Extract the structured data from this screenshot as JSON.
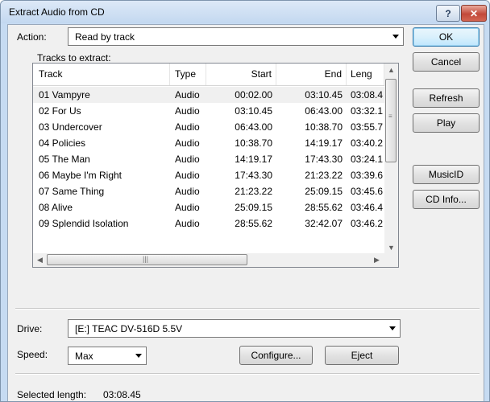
{
  "window": {
    "title": "Extract Audio from CD",
    "help_label": "?",
    "close_label": "✕"
  },
  "action": {
    "label": "Action:",
    "value": "Read by track"
  },
  "tracks_label": "Tracks to extract:",
  "columns": [
    "Track",
    "Type",
    "Start",
    "End",
    "Leng"
  ],
  "tracks": [
    {
      "track": "01 Vampyre",
      "type": "Audio",
      "start": "00:02.00",
      "end": "03:10.45",
      "length": "03:08.4"
    },
    {
      "track": "02 For Us",
      "type": "Audio",
      "start": "03:10.45",
      "end": "06:43.00",
      "length": "03:32.1"
    },
    {
      "track": "03 Undercover",
      "type": "Audio",
      "start": "06:43.00",
      "end": "10:38.70",
      "length": "03:55.7"
    },
    {
      "track": "04 Policies",
      "type": "Audio",
      "start": "10:38.70",
      "end": "14:19.17",
      "length": "03:40.2"
    },
    {
      "track": "05 The Man",
      "type": "Audio",
      "start": "14:19.17",
      "end": "17:43.30",
      "length": "03:24.1"
    },
    {
      "track": "06 Maybe I'm Right",
      "type": "Audio",
      "start": "17:43.30",
      "end": "21:23.22",
      "length": "03:39.6"
    },
    {
      "track": "07 Same Thing",
      "type": "Audio",
      "start": "21:23.22",
      "end": "25:09.15",
      "length": "03:45.6"
    },
    {
      "track": "08 Alive",
      "type": "Audio",
      "start": "25:09.15",
      "end": "28:55.62",
      "length": "03:46.4"
    },
    {
      "track": "09 Splendid Isolation",
      "type": "Audio",
      "start": "28:55.62",
      "end": "32:42.07",
      "length": "03:46.2"
    }
  ],
  "buttons": {
    "ok": "OK",
    "cancel": "Cancel",
    "refresh": "Refresh",
    "play": "Play",
    "musicid": "MusicID",
    "cd_info": "CD Info...",
    "configure": "Configure...",
    "eject": "Eject"
  },
  "drive": {
    "label": "Drive:",
    "value": "[E:] TEAC DV-516D 5.5V"
  },
  "speed": {
    "label": "Speed:",
    "value": "Max"
  },
  "status": {
    "label": "Selected length:",
    "value": "03:08.45"
  },
  "colors": {
    "frame": "#c6dbf2",
    "close": "#c2493a",
    "dialog_bg": "#f0f0f0"
  },
  "icons": {
    "scroll_up": "▲",
    "scroll_down": "▼",
    "scroll_left": "◀",
    "scroll_right": "▶",
    "grip": "|||"
  }
}
